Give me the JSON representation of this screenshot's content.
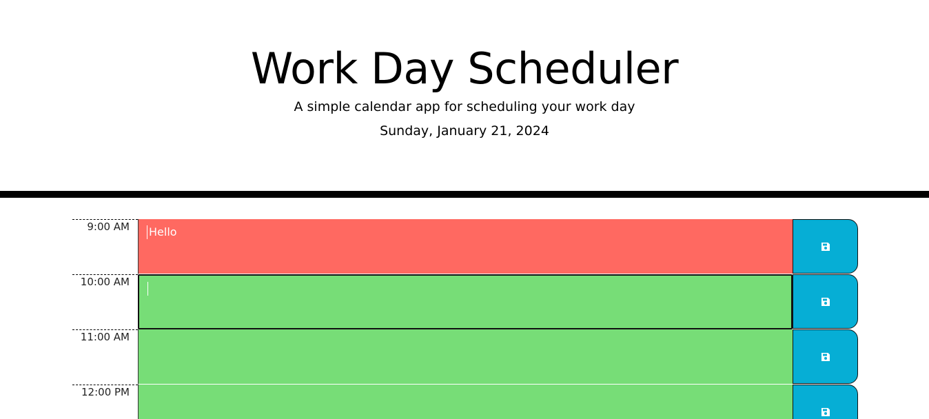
{
  "header": {
    "title": "Work Day Scheduler",
    "lead": "A simple calendar app for scheduling your work day",
    "current_day": "Sunday, January 21, 2024"
  },
  "rows": [
    {
      "hour": "9:00 AM",
      "text": "Hello",
      "status": "present",
      "color": "#ff6961"
    },
    {
      "hour": "10:00 AM",
      "text": "",
      "status": "future",
      "color": "#77dd77"
    },
    {
      "hour": "11:00 AM",
      "text": "",
      "status": "future",
      "color": "#77dd77"
    },
    {
      "hour": "12:00 PM",
      "text": "",
      "status": "future",
      "color": "#77dd77"
    }
  ],
  "save_button": {
    "icon": "floppy-disk-icon",
    "color": "#06aed5"
  }
}
